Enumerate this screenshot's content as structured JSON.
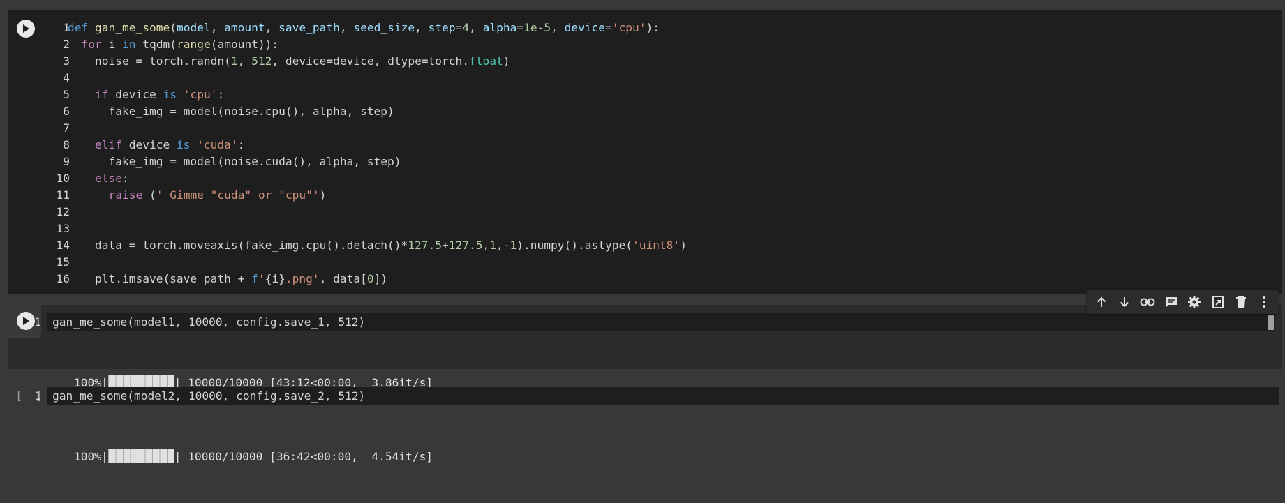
{
  "cells": [
    {
      "lines": [
        "1",
        "2",
        "3",
        "4",
        "5",
        "6",
        "7",
        "8",
        "9",
        "10",
        "11",
        "12",
        "13",
        "14",
        "15",
        "16"
      ]
    }
  ],
  "cell2": {
    "line_number": "1",
    "code": "gan_me_some(model1, 10000, config.save_1, 512)",
    "output": {
      "percent": "100%|",
      "progress_fraction": 1.0,
      "stats": "| 10000/10000 [43:12<00:00,  3.86it/s]"
    }
  },
  "cell3": {
    "bracket": "[ ]",
    "line_number": "1",
    "code": "gan_me_some(model2, 10000, config.save_2, 512)",
    "output": {
      "percent": "100%|",
      "progress_fraction": 1.0,
      "stats": "| 10000/10000 [36:42<00:00,  4.54it/s]"
    }
  },
  "toolbar": {
    "icons": [
      "arrow-up-icon",
      "arrow-down-icon",
      "link-icon",
      "comment-icon",
      "gear-icon",
      "mirror-cell-icon",
      "trash-icon",
      "more-vert-icon"
    ]
  },
  "colors": {
    "background": "#383838",
    "cell_background": "#1e1e1e",
    "keyword": "#569cd6",
    "control": "#c586c0",
    "string": "#ce9178",
    "number": "#b5cea8"
  }
}
